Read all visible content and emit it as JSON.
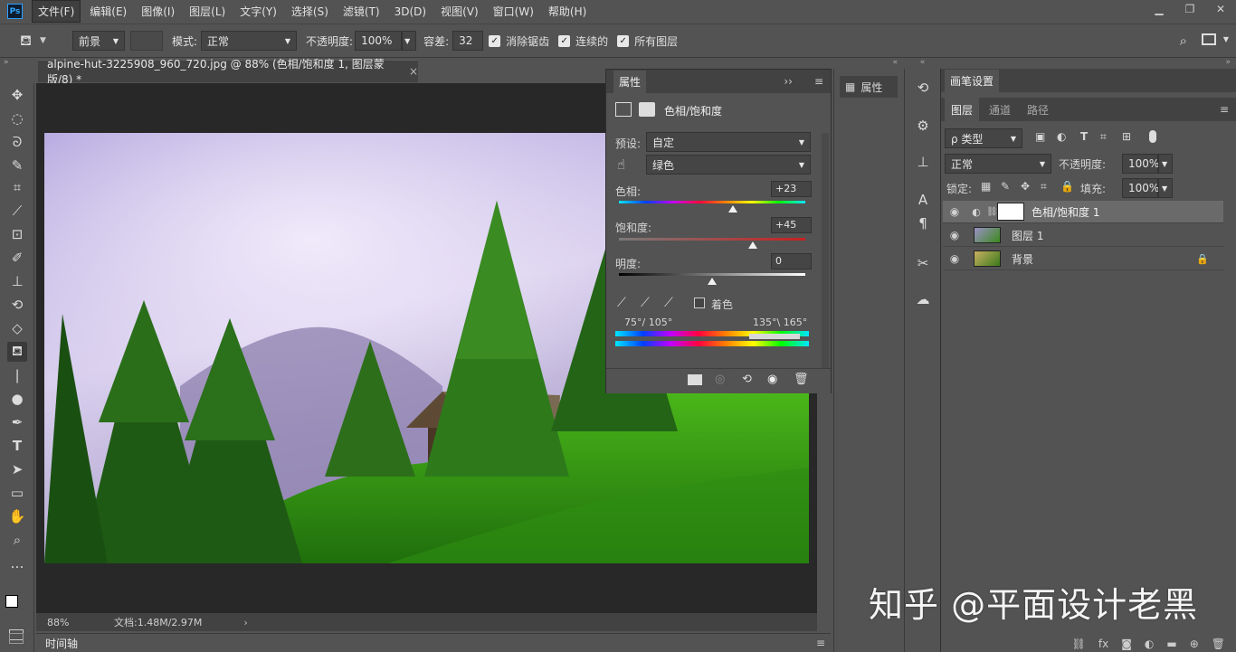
{
  "app": {
    "logo": "Ps"
  },
  "menu": [
    "文件(F)",
    "编辑(E)",
    "图像(I)",
    "图层(L)",
    "文字(Y)",
    "选择(S)",
    "滤镜(T)",
    "3D(D)",
    "视图(V)",
    "窗口(W)",
    "帮助(H)"
  ],
  "options": {
    "fill_source": "前景",
    "mode_label": "模式:",
    "mode_value": "正常",
    "opacity_label": "不透明度:",
    "opacity_value": "100%",
    "tolerance_label": "容差:",
    "tolerance_value": "32",
    "antialias_label": "消除锯齿",
    "contiguous_label": "连续的",
    "all_layers_label": "所有图层"
  },
  "document": {
    "tab_title": "alpine-hut-3225908_960_720.jpg @ 88% (色相/饱和度 1, 图层蒙版/8) *",
    "zoom": "88%",
    "doc_info": "文档:1.48M/2.97M",
    "timeline_label": "时间轴"
  },
  "properties": {
    "title": "属性",
    "adjust_name": "色相/饱和度",
    "preset_label": "预设:",
    "preset_value": "自定",
    "channel_value": "绿色",
    "hue_label": "色相:",
    "hue_value": "+23",
    "hue_level": 0.61,
    "sat_label": "饱和度:",
    "sat_value": "+45",
    "sat_level": 0.72,
    "light_label": "明度:",
    "light_value": "0",
    "light_level": 0.5,
    "colorize_label": "着色",
    "range_left": "75°/ 105°",
    "range_right": "135°\\ 165°"
  },
  "dock": {
    "properties_label": "属性"
  },
  "brush_settings_tab": "画笔设置",
  "layers_panel": {
    "tabs": [
      "图层",
      "通道",
      "路径"
    ],
    "filter_label": "ρ 类型",
    "blend_mode": "正常",
    "opacity_label": "不透明度:",
    "opacity_value": "100%",
    "lock_label": "锁定:",
    "fill_label": "填充:",
    "fill_value": "100%",
    "layers": [
      {
        "name": "色相/饱和度 1"
      },
      {
        "name": "图层 1"
      },
      {
        "name": "背景"
      }
    ]
  },
  "watermark": "知乎 @平面设计老黑",
  "colors": {
    "accent": "#31a8ff",
    "panel": "#535353",
    "panel_dark": "#424242"
  }
}
